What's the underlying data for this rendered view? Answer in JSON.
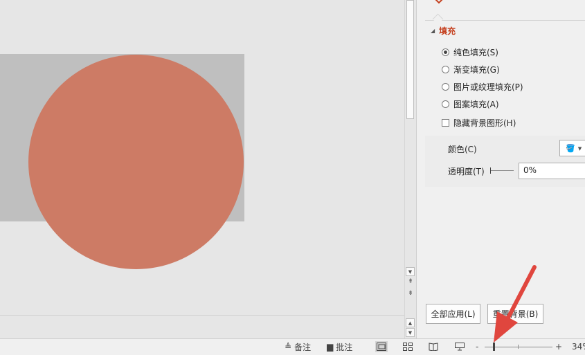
{
  "pane": {
    "section_title": "填充",
    "fill_options": [
      {
        "label": "纯色填充(S)",
        "selected": true
      },
      {
        "label": "渐变填充(G)",
        "selected": false
      },
      {
        "label": "图片或纹理填充(P)",
        "selected": false
      },
      {
        "label": "图案填充(A)",
        "selected": false
      }
    ],
    "hide_bg_graphics_label": "隐藏背景图形(H)",
    "color_label": "颜色(C)",
    "transparency_label": "透明度(T)",
    "transparency_value": "0%",
    "apply_all_label": "全部应用(L)",
    "reset_bg_label": "重置背景(B)"
  },
  "statusbar": {
    "notes_label": "备注",
    "comments_label": "批注",
    "zoom_minus": "-",
    "zoom_plus": "+",
    "zoom_value": "34%"
  },
  "colors": {
    "accent": "#c43e1c",
    "circle_fill": "#cd7b65",
    "slide_bg": "#bfbfbf",
    "annotation_arrow": "#e0463e"
  }
}
